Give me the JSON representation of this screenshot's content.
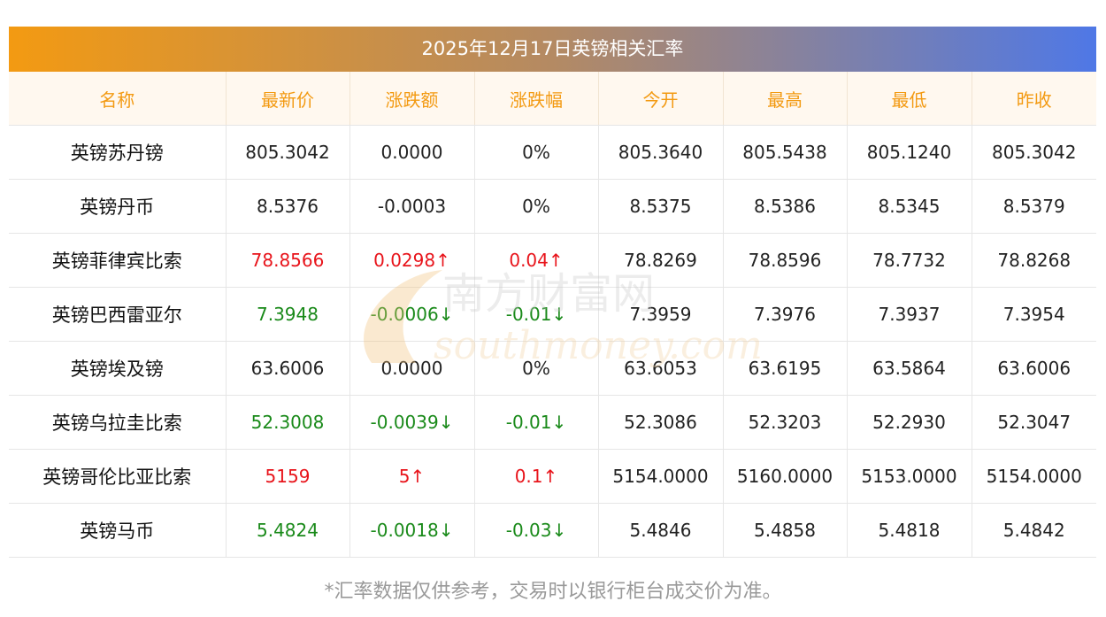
{
  "title": "2025年12月17日英镑相关汇率",
  "columns": [
    "名称",
    "最新价",
    "涨跌额",
    "涨跌幅",
    "今开",
    "最高",
    "最低",
    "昨收"
  ],
  "rows": [
    {
      "name": "英镑苏丹镑",
      "latest": "805.3042",
      "change": "0.0000",
      "pct": "0%",
      "open": "805.3640",
      "high": "805.5438",
      "low": "805.1240",
      "prev": "805.3042",
      "trend": "flat"
    },
    {
      "name": "英镑丹币",
      "latest": "8.5376",
      "change": "-0.0003",
      "pct": "0%",
      "open": "8.5375",
      "high": "8.5386",
      "low": "8.5345",
      "prev": "8.5379",
      "trend": "flat"
    },
    {
      "name": "英镑菲律宾比索",
      "latest": "78.8566",
      "change": "0.0298↑",
      "pct": "0.04↑",
      "open": "78.8269",
      "high": "78.8596",
      "low": "78.7732",
      "prev": "78.8268",
      "trend": "up"
    },
    {
      "name": "英镑巴西雷亚尔",
      "latest": "7.3948",
      "change": "-0.0006↓",
      "pct": "-0.01↓",
      "open": "7.3959",
      "high": "7.3976",
      "low": "7.3937",
      "prev": "7.3954",
      "trend": "down"
    },
    {
      "name": "英镑埃及镑",
      "latest": "63.6006",
      "change": "0.0000",
      "pct": "0%",
      "open": "63.6053",
      "high": "63.6195",
      "low": "63.5864",
      "prev": "63.6006",
      "trend": "flat"
    },
    {
      "name": "英镑乌拉圭比索",
      "latest": "52.3008",
      "change": "-0.0039↓",
      "pct": "-0.01↓",
      "open": "52.3086",
      "high": "52.3203",
      "low": "52.2930",
      "prev": "52.3047",
      "trend": "down"
    },
    {
      "name": "英镑哥伦比亚比索",
      "latest": "5159",
      "change": "5↑",
      "pct": "0.1↑",
      "open": "5154.0000",
      "high": "5160.0000",
      "low": "5153.0000",
      "prev": "5154.0000",
      "trend": "up"
    },
    {
      "name": "英镑马币",
      "latest": "5.4824",
      "change": "-0.0018↓",
      "pct": "-0.03↓",
      "open": "5.4846",
      "high": "5.4858",
      "low": "5.4818",
      "prev": "5.4842",
      "trend": "down"
    }
  ],
  "footnote": "*汇率数据仅供参考，交易时以银行柜台成交价为准。",
  "watermark": {
    "brand": "南方财富网",
    "domain": "southmoney.com"
  },
  "colors": {
    "up": "#e8141b",
    "down": "#1a8a1a",
    "header_text": "#f39a12"
  }
}
